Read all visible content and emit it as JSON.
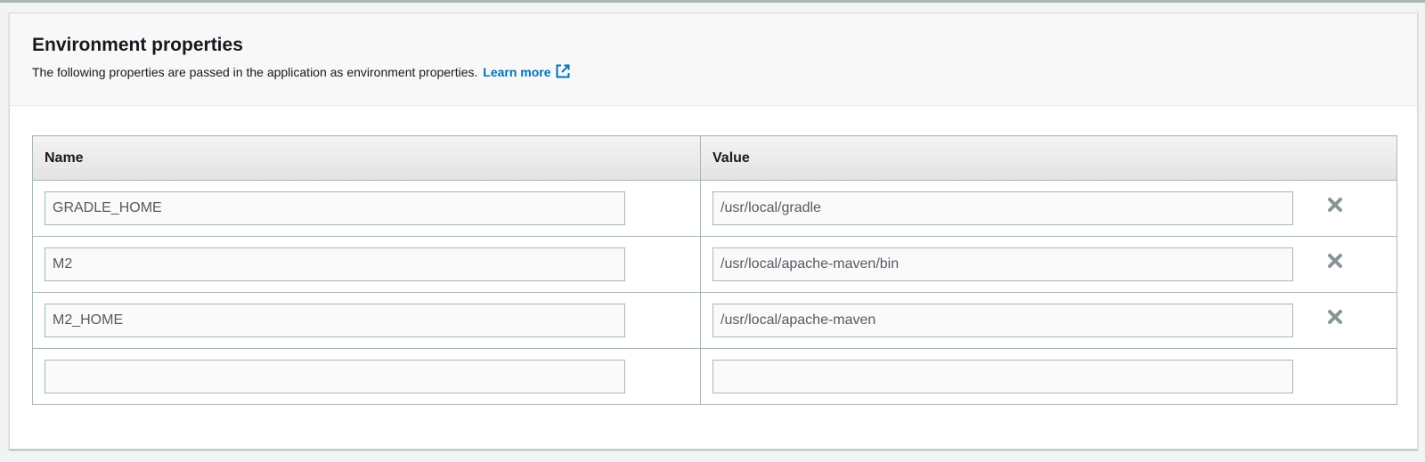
{
  "panel": {
    "title": "Environment properties",
    "description": "The following properties are passed in the application as environment properties.",
    "learn_more_label": "Learn more"
  },
  "table": {
    "columns": [
      "Name",
      "Value"
    ],
    "rows": [
      {
        "name": "GRADLE_HOME",
        "value": "/usr/local/gradle",
        "removable": true
      },
      {
        "name": "M2",
        "value": "/usr/local/apache-maven/bin",
        "removable": true
      },
      {
        "name": "M2_HOME",
        "value": "/usr/local/apache-maven",
        "removable": true
      },
      {
        "name": "",
        "value": "",
        "removable": false
      }
    ]
  },
  "icons": {
    "learn_more": "external-link-icon",
    "remove": "close-icon"
  },
  "colors": {
    "link": "#0073bb",
    "remove_icon": "#879596",
    "header_bg": "#f8f8f8"
  }
}
